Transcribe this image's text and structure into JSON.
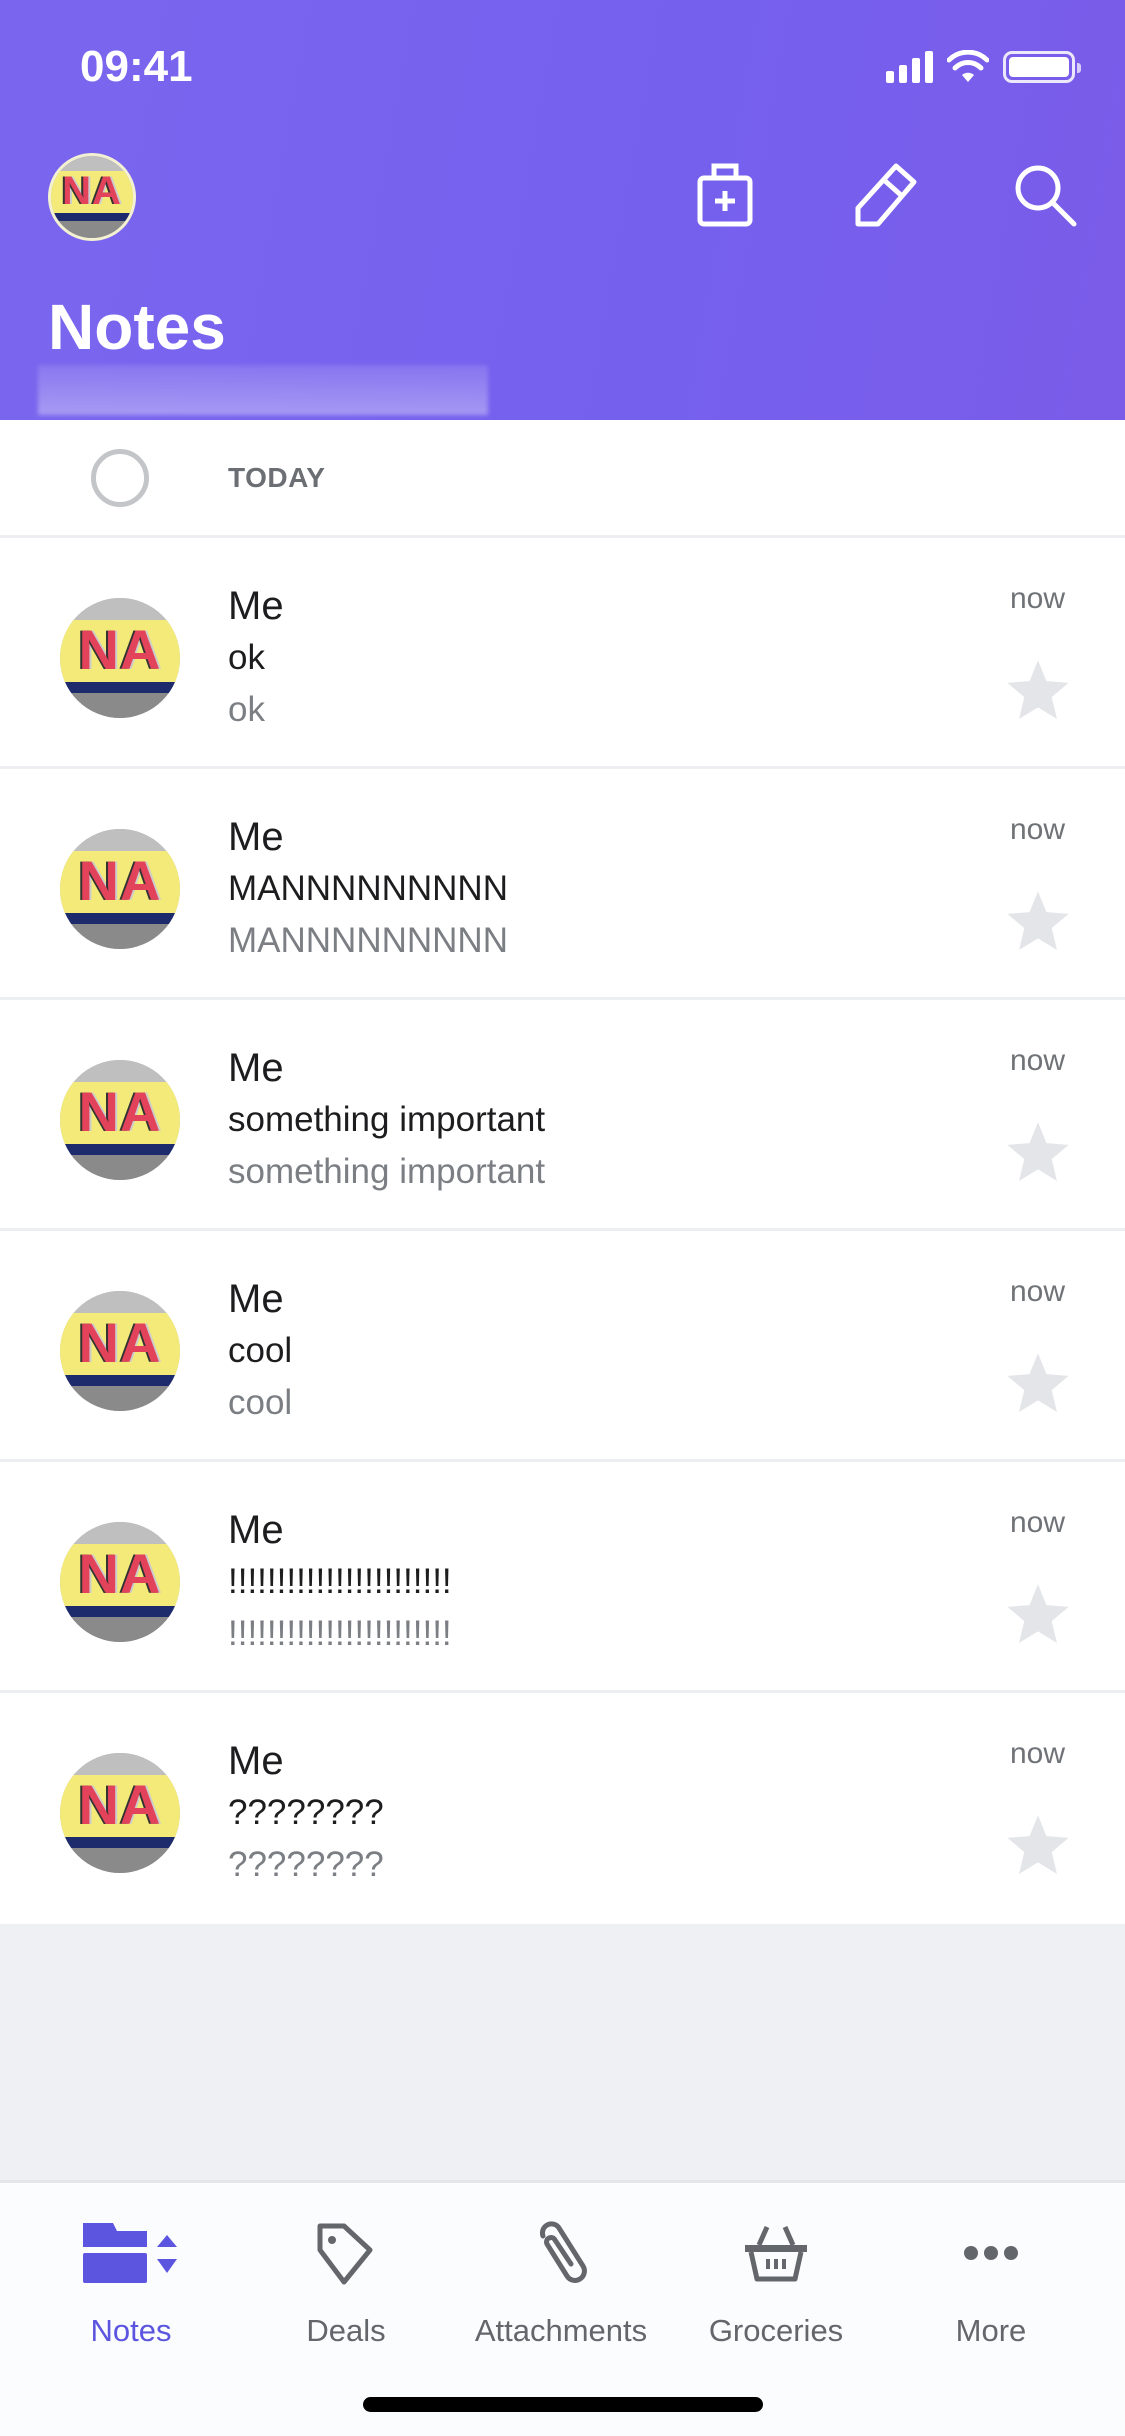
{
  "status_bar": {
    "time": "09:41"
  },
  "header": {
    "title": "Notes",
    "avatar_initials": "NA",
    "actions": [
      {
        "name": "new-folder",
        "icon": "medical-kit-plus-icon"
      },
      {
        "name": "compose",
        "icon": "eraser-pencil-icon"
      },
      {
        "name": "search",
        "icon": "search-icon"
      }
    ]
  },
  "list": {
    "section_label": "TODAY",
    "rows": [
      {
        "avatar_initials": "NA",
        "sender": "Me",
        "subject": "ok",
        "preview": "ok",
        "time": "now",
        "starred": false
      },
      {
        "avatar_initials": "NA",
        "sender": "Me",
        "subject": "MANNNNNNNNN",
        "preview": "MANNNNNNNNN",
        "time": "now",
        "starred": false
      },
      {
        "avatar_initials": "NA",
        "sender": "Me",
        "subject": "something important",
        "preview": "something important",
        "time": "now",
        "starred": false
      },
      {
        "avatar_initials": "NA",
        "sender": "Me",
        "subject": "cool",
        "preview": "cool",
        "time": "now",
        "starred": false
      },
      {
        "avatar_initials": "NA",
        "sender": "Me",
        "subject": "!!!!!!!!!!!!!!!!!!!!!!!",
        "preview": "!!!!!!!!!!!!!!!!!!!!!!!",
        "time": "now",
        "starred": false
      },
      {
        "avatar_initials": "NA",
        "sender": "Me",
        "subject": "????????",
        "preview": "????????",
        "time": "now",
        "starred": false
      }
    ]
  },
  "tabbar": {
    "tabs": [
      {
        "label": "Notes",
        "icon": "folder-sort-icon",
        "active": true
      },
      {
        "label": "Deals",
        "icon": "tag-icon",
        "active": false
      },
      {
        "label": "Attachments",
        "icon": "paperclip-icon",
        "active": false
      },
      {
        "label": "Groceries",
        "icon": "basket-icon",
        "active": false
      },
      {
        "label": "More",
        "icon": "more-dots-icon",
        "active": false
      }
    ]
  },
  "colors": {
    "brand": "#7763ee",
    "active_tab": "#5b55e0",
    "inactive_tab": "#63666b",
    "star_off": "#e3e5e8"
  }
}
